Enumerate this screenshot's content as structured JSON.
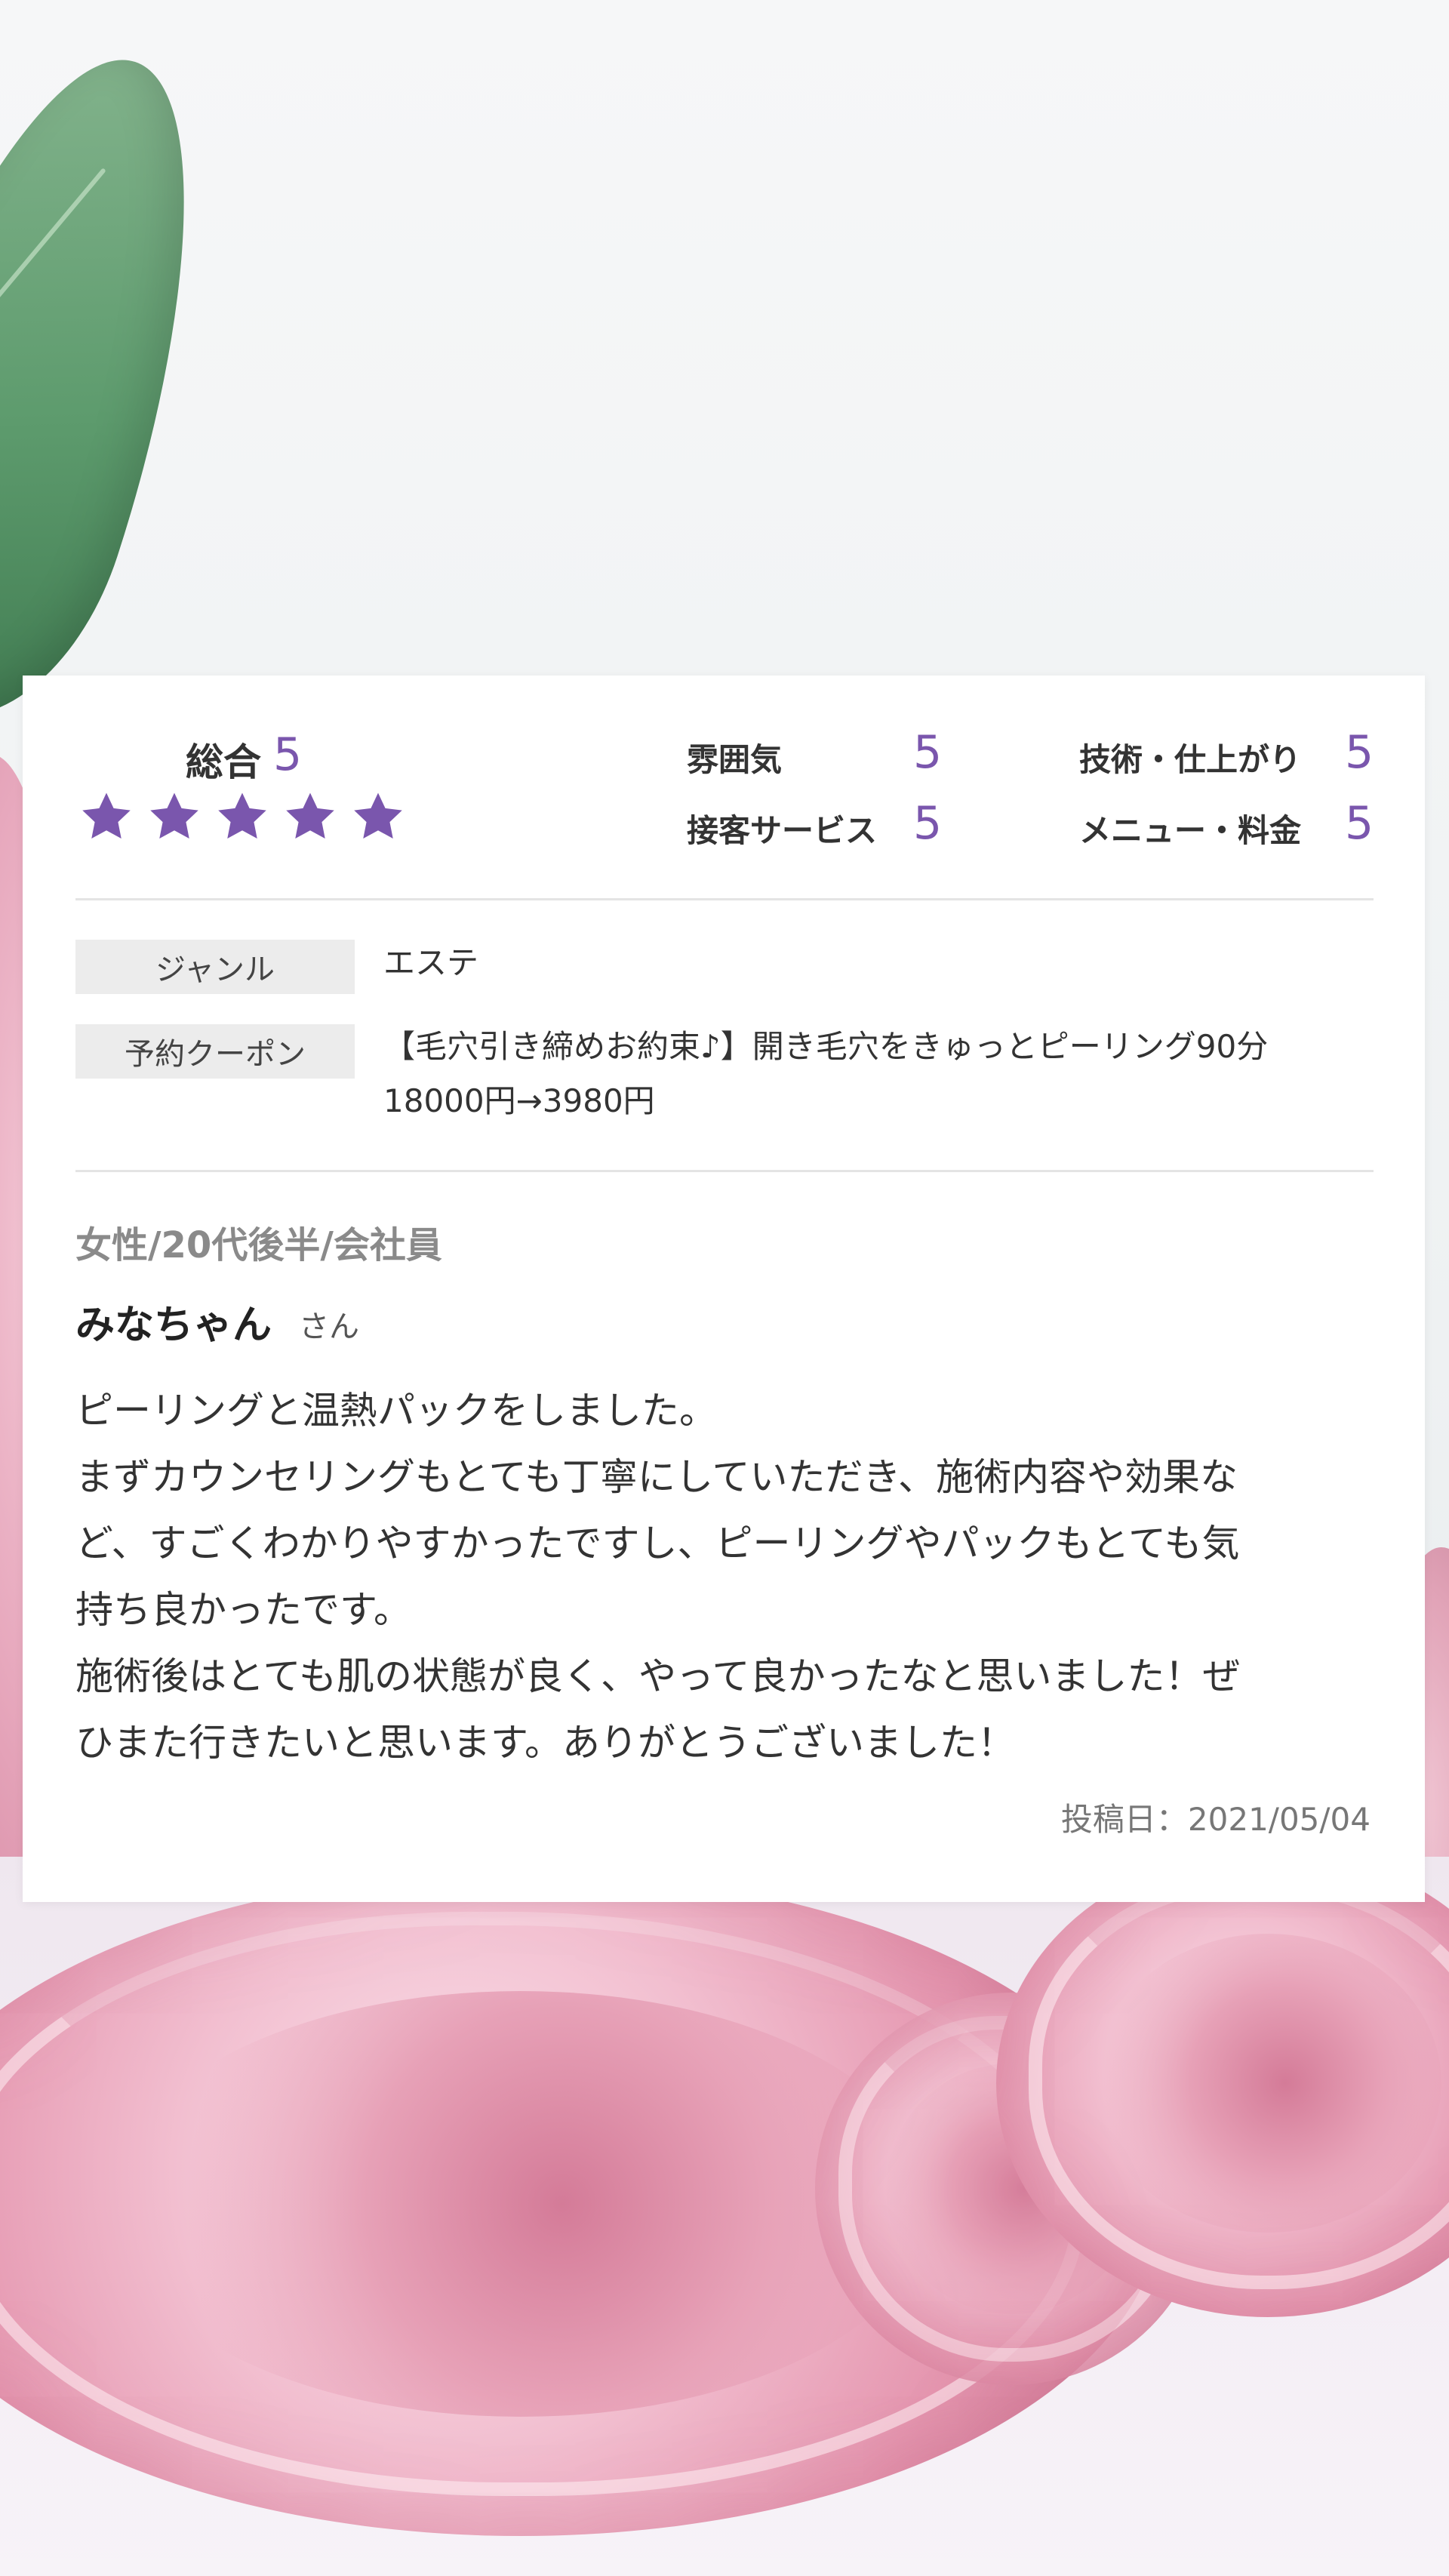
{
  "ratings": {
    "overall_label": "総合",
    "overall_value": "5",
    "stars": 5,
    "star_color": "#7a56ad",
    "categories": [
      {
        "label": "雰囲気",
        "value": "5"
      },
      {
        "label": "技術・仕上がり",
        "value": "5"
      },
      {
        "label": "接客サービス",
        "value": "5"
      },
      {
        "label": "メニュー・料金",
        "value": "5"
      }
    ]
  },
  "info": {
    "genre_label": "ジャンル",
    "genre_value": "エステ",
    "coupon_label": "予約クーポン",
    "coupon_lines": [
      "【毛穴引き締めお約束♪】開き毛穴をきゅっとピーリング90分",
      "18000円→3980円"
    ]
  },
  "reviewer": {
    "meta": "女性/20代後半/会社員",
    "name": "みなちゃん",
    "honorific": "さん"
  },
  "review_lines": [
    "ピーリングと温熱パックをしました。",
    "まずカウンセリングもとても丁寧にしていただき、施術内容や効果な",
    "ど、すごくわかりやすかったですし、ピーリングやパックもとても気",
    "持ち良かったです。",
    "施術後はとても肌の状態が良く、やって良かったなと思いました！ぜ",
    "ひまた行きたいと思います。ありがとうございました！"
  ],
  "posted": "投稿日：2021/05/04"
}
